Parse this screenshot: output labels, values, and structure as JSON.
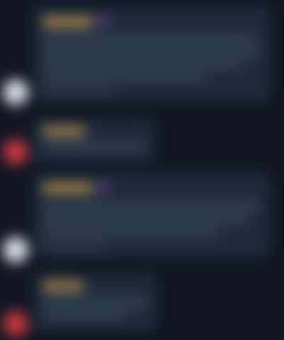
{
  "feed": {
    "messages": [
      {
        "author": "",
        "text": "",
        "avatar_color": "#d8dbe0",
        "name_color": "#b08b4a",
        "accent_color": "#7e4a9a"
      },
      {
        "author": "",
        "text": "",
        "avatar_color": "#c23742",
        "name_color": "#a8824c",
        "accent_color": ""
      },
      {
        "author": "",
        "text": "",
        "avatar_color": "#d8dbe0",
        "name_color": "#b08b4a",
        "accent_color": "#7e4a9a"
      },
      {
        "author": "",
        "text": "",
        "avatar_color": "#c23742",
        "name_color": "#a8824c",
        "accent_color": ""
      }
    ]
  },
  "colors": {
    "background": "#121723",
    "bubble": "#1e2b3c"
  }
}
